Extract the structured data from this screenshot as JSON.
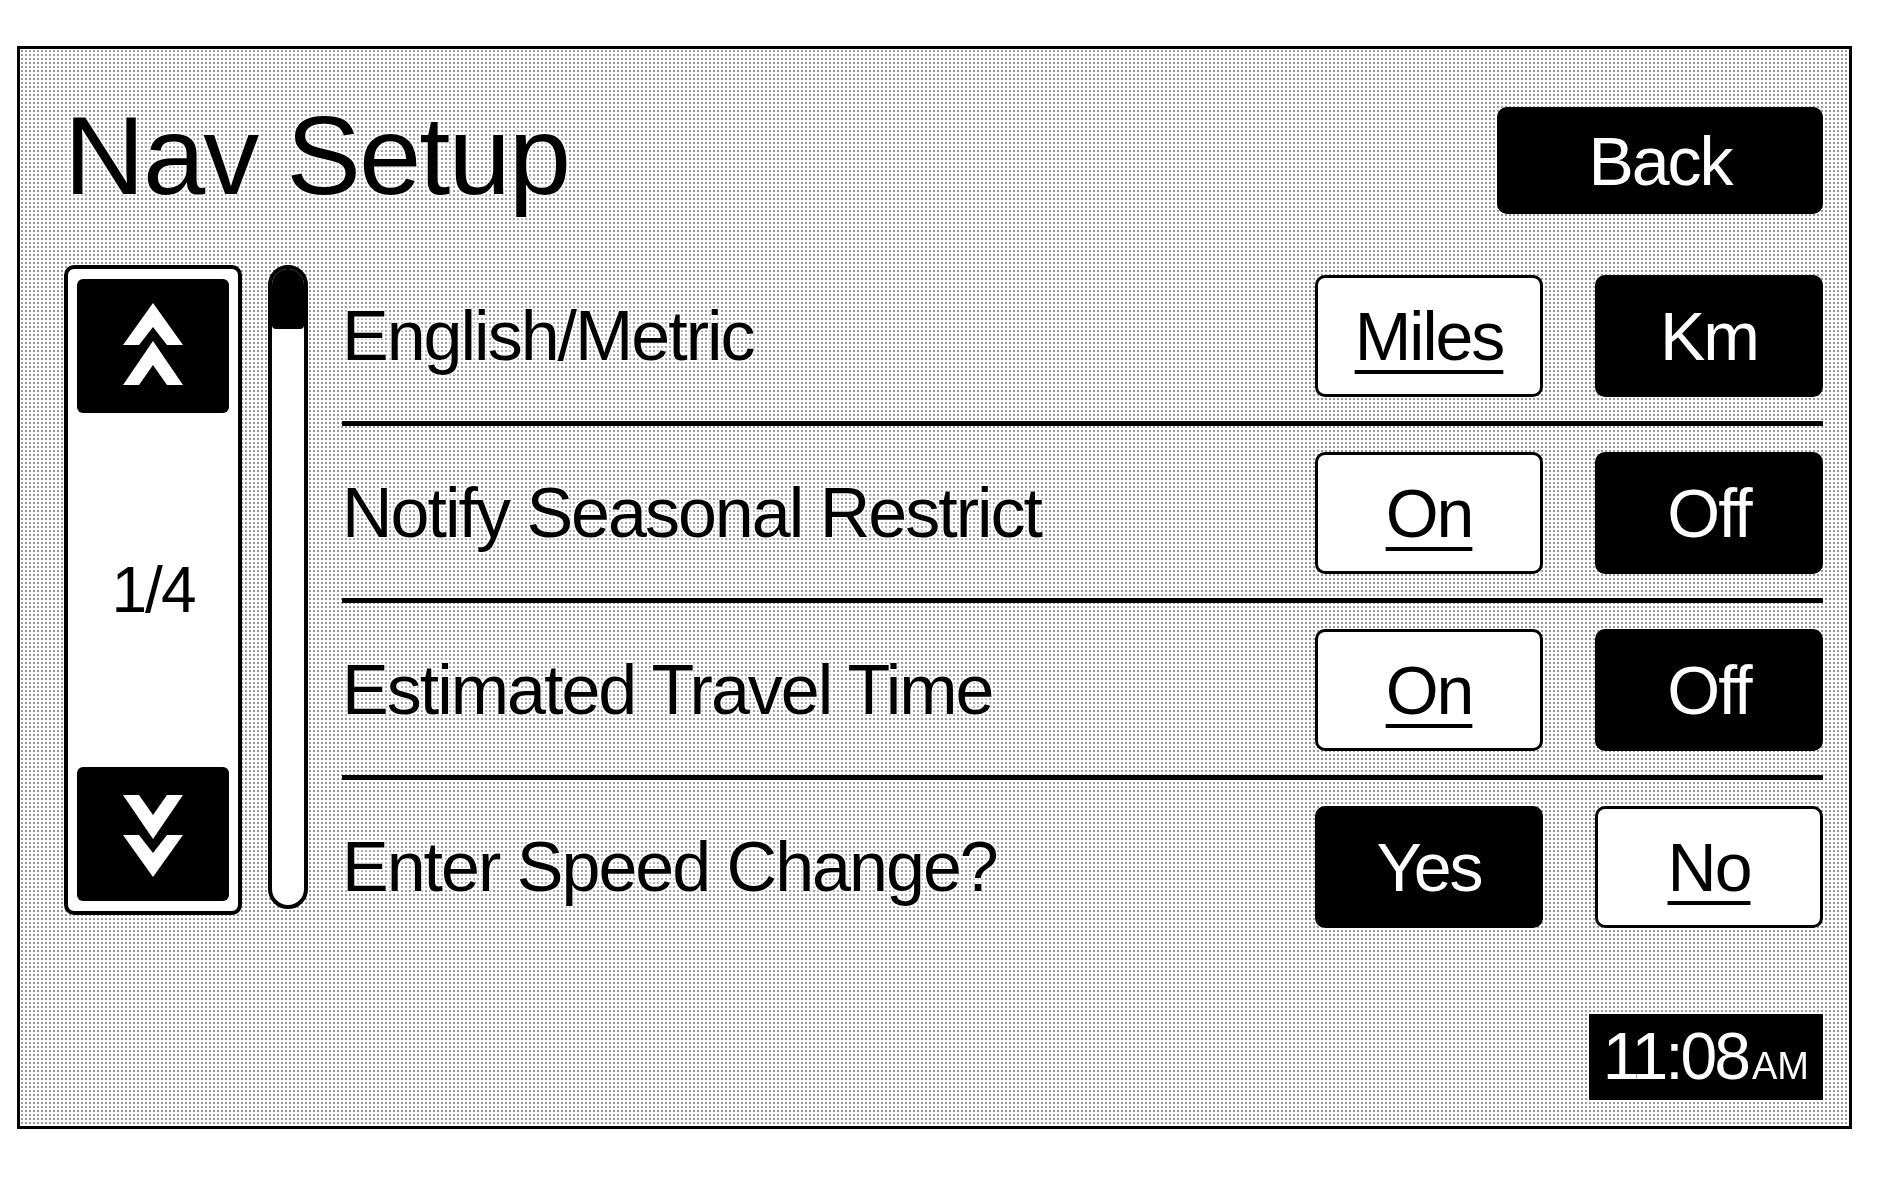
{
  "title": "Nav Setup",
  "back_button": "Back",
  "page_indicator": "1/4",
  "settings": [
    {
      "label": "English/Metric",
      "options": [
        {
          "label": "Miles",
          "selected": true
        },
        {
          "label": "Km",
          "selected": false
        }
      ]
    },
    {
      "label": "Notify Seasonal Restrict",
      "options": [
        {
          "label": "On",
          "selected": true
        },
        {
          "label": "Off",
          "selected": false
        }
      ]
    },
    {
      "label": "Estimated Travel Time",
      "options": [
        {
          "label": "On",
          "selected": true
        },
        {
          "label": "Off",
          "selected": false
        }
      ]
    },
    {
      "label": "Enter Speed Change?",
      "options": [
        {
          "label": "Yes",
          "selected": false
        },
        {
          "label": "No",
          "selected": true
        }
      ]
    }
  ],
  "clock": {
    "time": "11:08",
    "period": "AM"
  }
}
